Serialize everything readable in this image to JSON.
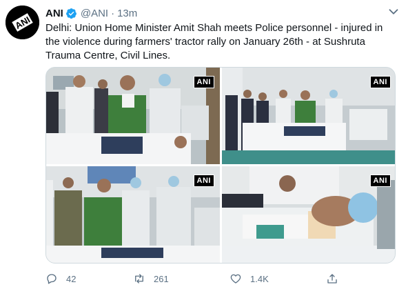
{
  "author": {
    "name": "ANI",
    "handle": "@ANI",
    "separator": "·",
    "time": "13m",
    "avatar_text": "ANI"
  },
  "tweet": {
    "text": "Delhi: Union Home Minister Amit Shah meets Police personnel - injured in the violence during farmers' tractor rally on January 26th - at Sushruta Trauma Centre, Civil Lines."
  },
  "media": {
    "watermark": "ANI"
  },
  "actions": {
    "replies": "42",
    "retweets": "261",
    "likes": "1.4K"
  },
  "icons": {
    "verified": "verified-badge-icon",
    "more": "more-options-icon",
    "reply": "reply-icon",
    "retweet": "retweet-icon",
    "like": "heart-icon",
    "share": "share-icon"
  },
  "colors": {
    "verified": "#1da1f2",
    "secondary_text": "#5b7083",
    "border": "#cfd9de"
  }
}
